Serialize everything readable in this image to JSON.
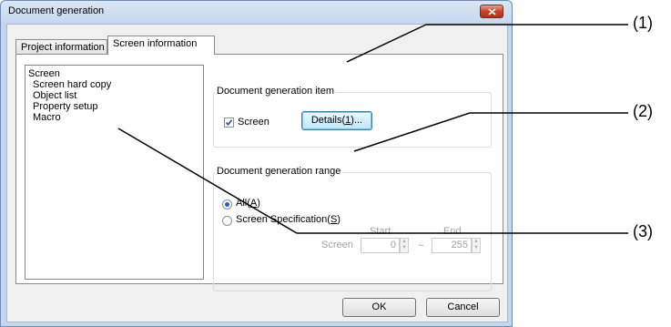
{
  "window": {
    "title": "Document generation"
  },
  "tabs": [
    {
      "label": "Project information",
      "active": false
    },
    {
      "label": "Screen information",
      "active": true
    }
  ],
  "screen_list": {
    "items": [
      {
        "label": "Screen",
        "level": 0
      },
      {
        "label": "Screen hard copy",
        "level": 1
      },
      {
        "label": "Object list",
        "level": 1
      },
      {
        "label": "Property setup",
        "level": 1
      },
      {
        "label": "Macro",
        "level": 1
      }
    ]
  },
  "generation_item": {
    "group_title": "Document generation item",
    "screen_checkbox_label": "Screen",
    "screen_checked": true,
    "details_button": "Details(1)..."
  },
  "generation_range": {
    "group_title": "Document generation range",
    "all_label": "All(A)",
    "all_selected": true,
    "spec_label": "Screen Specification(S)",
    "start_label": "Start",
    "end_label": "End",
    "screen_label": "Screen",
    "start_value": "0",
    "end_value": "255",
    "tilde": "~"
  },
  "footer": {
    "ok_label": "OK",
    "cancel_label": "Cancel"
  },
  "callouts": [
    "(1)",
    "(2)",
    "(3)"
  ],
  "colors": {
    "title_gradient": "#c9d9ee",
    "close_button": "#c7412a",
    "radio_selected": "#1e5fb8"
  }
}
